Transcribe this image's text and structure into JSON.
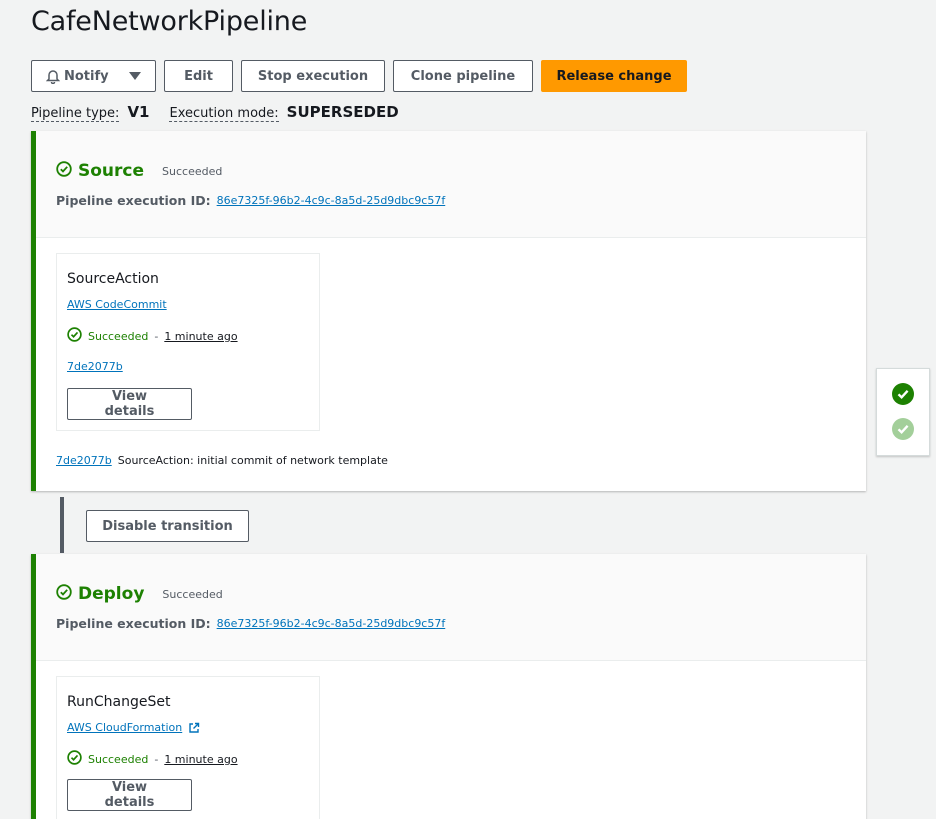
{
  "page": {
    "title": "CafeNetworkPipeline"
  },
  "toolbar": {
    "notify_label": "Notify",
    "edit_label": "Edit",
    "stop_label": "Stop execution",
    "clone_label": "Clone pipeline",
    "release_label": "Release change"
  },
  "meta": {
    "pipeline_type_label": "Pipeline type:",
    "pipeline_type_value": "V1",
    "execution_mode_label": "Execution mode:",
    "execution_mode_value": "SUPERSEDED"
  },
  "stages": [
    {
      "name": "Source",
      "status": "Succeeded",
      "exec_label": "Pipeline execution ID:",
      "exec_id": "86e7325f-96b2-4c9c-8a5d-25d9dbc9c57f",
      "action": {
        "name": "SourceAction",
        "provider": "AWS CodeCommit",
        "status": "Succeeded",
        "separator": "-",
        "time": "1 minute ago",
        "revision": "7de2077b",
        "view_label": "View details"
      },
      "commit": {
        "id": "7de2077b",
        "message": "SourceAction: initial commit of network template"
      }
    },
    {
      "name": "Deploy",
      "status": "Succeeded",
      "exec_label": "Pipeline execution ID:",
      "exec_id": "86e7325f-96b2-4c9c-8a5d-25d9dbc9c57f",
      "action": {
        "name": "RunChangeSet",
        "provider": "AWS CloudFormation",
        "status": "Succeeded",
        "separator": "-",
        "time": "1 minute ago",
        "view_label": "View details"
      }
    }
  ],
  "transition": {
    "label": "Disable transition"
  },
  "colors": {
    "success": "#1d8102",
    "primary": "#ff9900",
    "link": "#0073bb"
  },
  "icons": [
    "bell-icon",
    "caret-down-icon",
    "check-circle-icon",
    "external-link-icon"
  ]
}
